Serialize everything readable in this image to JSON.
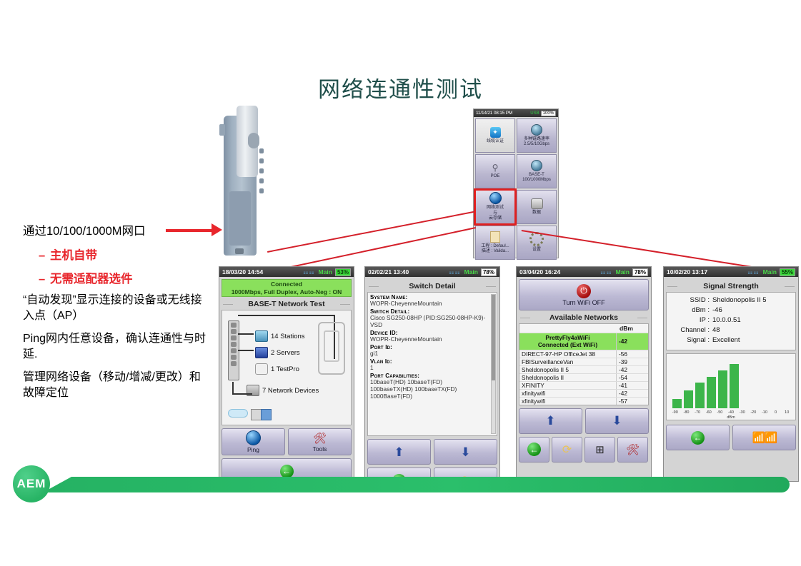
{
  "slide": {
    "title": "网络连通性测试",
    "logo_text": "AEM",
    "accent_green": "#25b263",
    "accent_red": "#e8262c"
  },
  "left_panel": {
    "heading": "通过10/100/1000M网口",
    "bullets": [
      {
        "dash": "–",
        "text": "主机自带"
      },
      {
        "dash": "–",
        "text": "无需适配器选件"
      }
    ],
    "paragraphs": [
      "“自动发现”显示连接的设备或无线接入点（AP）",
      "Ping网内任意设备，确认连通性与时延.",
      "管理网络设备（移动/增减/更改）和故障定位"
    ]
  },
  "menu_screen": {
    "status": {
      "datetime": "11/14/21 08:15 PM",
      "usb": "USB",
      "battery": "100%"
    },
    "tiles": [
      {
        "label": "线缆认证",
        "sub": "",
        "icon": "cable-cert-icon",
        "selected": false,
        "style": "grey"
      },
      {
        "label": "多种链路速率",
        "sub": "2.5/5/10Gbps",
        "icon": "link-speed-icon",
        "selected": false,
        "style": "normal"
      },
      {
        "label": "POE",
        "sub": "",
        "icon": "poe-icon",
        "selected": false,
        "style": "normal"
      },
      {
        "label": "BASE-T",
        "sub": "100/1000Mbps",
        "icon": "base-t-icon",
        "selected": false,
        "style": "normal"
      },
      {
        "label": "网络测试\n与\n云存储",
        "sub": "",
        "icon": "globe-icon",
        "selected": true,
        "style": "normal"
      },
      {
        "label": "数据",
        "sub": "",
        "icon": "database-icon",
        "selected": false,
        "style": "normal"
      },
      {
        "label": "工程 : Defaul...\n描述 : Valida...",
        "sub": "",
        "icon": "file-icon",
        "selected": false,
        "style": "normal"
      },
      {
        "label": "设置",
        "sub": "",
        "icon": "gear-icon",
        "selected": false,
        "style": "normal"
      }
    ]
  },
  "screens": [
    {
      "id": "base-t-network-test",
      "status": {
        "datetime": "18/03/20 14:54",
        "main": "Main",
        "battery": "53%",
        "battery_green": true
      },
      "banner_line1": "Connected",
      "banner_line2": "1000Mbps, Full Duplex, Auto-Neg : ON",
      "section_title": "BASE-T Network Test",
      "topology": [
        {
          "count": "14 Stations",
          "icon": "monitor-icon"
        },
        {
          "count": "2 Servers",
          "icon": "server-icon"
        },
        {
          "count": "1 TestPro",
          "icon": "testpro-icon"
        },
        {
          "count": "7 Network Devices",
          "icon": "network-device-icon"
        }
      ],
      "buttons": [
        {
          "label": "Ping",
          "icon": "globe-icon"
        },
        {
          "label": "Tools",
          "icon": "tools-icon"
        }
      ],
      "nav": [
        {
          "label": "",
          "icon": "back-arrow-icon"
        }
      ]
    },
    {
      "id": "switch-detail",
      "status": {
        "datetime": "02/02/21 13:40",
        "main": "Main",
        "battery": "78%",
        "battery_green": false
      },
      "section_title": "Switch Detail",
      "fields": [
        {
          "key": "System Name:",
          "value": "WOPR-CheyenneMountain"
        },
        {
          "key": "Switch Detail:",
          "value": "Cisco SG250-08HP (PID:SG250-08HP-K9)-VSD"
        },
        {
          "key": "Device ID:",
          "value": "WOPR-CheyenneMountain"
        },
        {
          "key": "Port Id:",
          "value": "gi1"
        },
        {
          "key": "Vlan Id:",
          "value": "1"
        },
        {
          "key": "Port Capabilities:",
          "value": "10baseT(HD) 10baseT(FD)\n100baseTX(HD) 100baseTX(FD)\n1000BaseT(FD)"
        }
      ],
      "buttons": [
        {
          "icon": "upload-icon"
        },
        {
          "icon": "download-icon"
        },
        {
          "icon": "back-arrow-icon"
        },
        {
          "icon": "refresh-icon"
        }
      ]
    },
    {
      "id": "wifi-available-networks",
      "status": {
        "datetime": "03/04/20 16:24",
        "main": "Main",
        "battery": "78%",
        "battery_green": false
      },
      "wifi_toggle_label": "Turn WiFi OFF",
      "section_title": "Available Networks",
      "column_header": "dBm",
      "connected": {
        "ssid": "PrettyFly4aWiFi",
        "state": "Connected (Ext WiFi)",
        "dbm": "-42"
      },
      "networks": [
        {
          "ssid": "DIRECT-97-HP OfficeJet 38",
          "dbm": "-56"
        },
        {
          "ssid": "FBISurveillanceVan",
          "dbm": "-39"
        },
        {
          "ssid": "Sheldonopolis II 5",
          "dbm": "-42"
        },
        {
          "ssid": "Sheldonopolis II",
          "dbm": "-54"
        },
        {
          "ssid": "XFINITY",
          "dbm": "-41"
        },
        {
          "ssid": "xfinitywifi",
          "dbm": "-42"
        },
        {
          "ssid": "xfinitywifi",
          "dbm": "-57"
        }
      ],
      "buttons": [
        {
          "icon": "upload-icon"
        },
        {
          "icon": "download-icon"
        },
        {
          "icon": "back-arrow-icon"
        },
        {
          "icon": "refresh-icon"
        },
        {
          "icon": "split-view-icon"
        },
        {
          "icon": "tools-icon"
        }
      ]
    },
    {
      "id": "signal-strength",
      "status": {
        "datetime": "10/02/20 13:17",
        "main": "Main",
        "battery": "55%",
        "battery_green": true
      },
      "section_title": "Signal Strength",
      "details": [
        {
          "key": "SSID :",
          "value": "Sheldonopolis II 5"
        },
        {
          "key": "dBm :",
          "value": "-46"
        },
        {
          "key": "IP :",
          "value": "10.0.0.51"
        },
        {
          "key": "Channel :",
          "value": "48"
        },
        {
          "key": "Signal :",
          "value": "Excellent"
        }
      ],
      "buttons": [
        {
          "icon": "back-arrow-icon"
        },
        {
          "icon": "dual-wifi-icon"
        }
      ]
    }
  ],
  "chart_data": {
    "type": "bar",
    "title": "Signal Strength",
    "xlabel": "dBm",
    "ylabel": "",
    "categories": [
      "-90",
      "-80",
      "-70",
      "-60",
      "-50",
      "-40",
      "-30",
      "-20",
      "-10",
      "0",
      "10"
    ],
    "values": [
      14,
      27,
      38,
      47,
      56,
      66,
      0,
      0,
      0,
      0,
      0
    ],
    "bar_color": "#3cb54a",
    "grid": false,
    "legend": "none",
    "ylim": [
      0,
      70
    ]
  }
}
